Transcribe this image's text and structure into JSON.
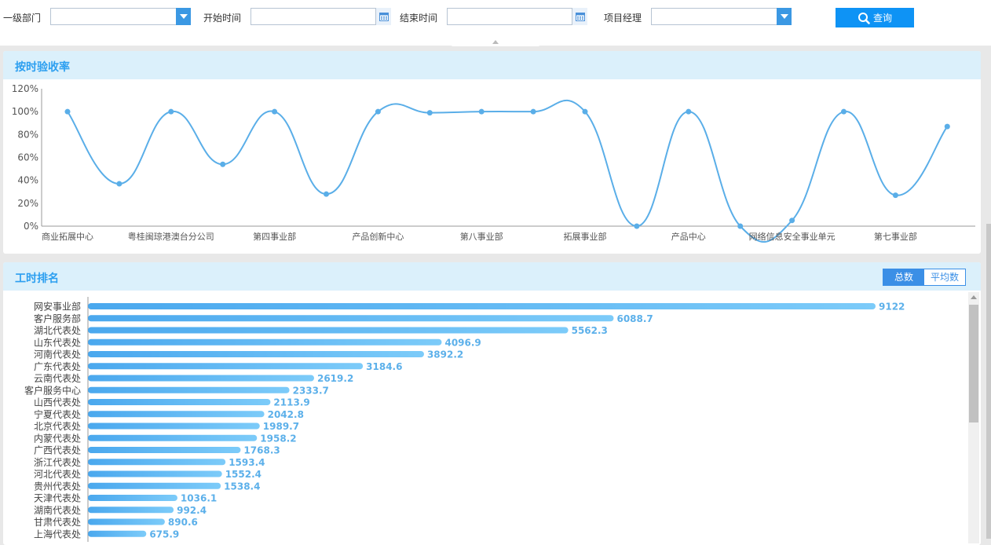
{
  "filters": {
    "dept_label": "一级部门",
    "start_label": "开始时间",
    "end_label": "结束时间",
    "manager_label": "项目经理",
    "dept_value": "",
    "start_value": "",
    "end_value": "",
    "manager_value": "",
    "query_label": "查询"
  },
  "colors": {
    "accent": "#2c9ff0",
    "line": "#5aaee8",
    "bar": "#5cb8f5",
    "button": "#0e93f5"
  },
  "icons": [
    "chevron-down-icon",
    "calendar-icon",
    "search-icon"
  ],
  "panel1": {
    "title": "按时验收率"
  },
  "panel2": {
    "title": "工时排名",
    "toggle_total": "总数",
    "toggle_avg": "平均数"
  },
  "chart_data": [
    {
      "type": "line",
      "title": "按时验收率",
      "y_ticks": [
        "0%",
        "20%",
        "40%",
        "60%",
        "80%",
        "100%",
        "120%"
      ],
      "ylim": [
        0,
        120
      ],
      "x_labels_shown": [
        "商业拓展中心",
        "粤桂闽琼港澳台分公司",
        "第四事业部",
        "产品创新中心",
        "第八事业部",
        "拓展事业部",
        "产品中心",
        "网络信息安全事业单元",
        "第七事业部"
      ],
      "values": [
        100,
        37,
        100,
        54,
        100,
        28,
        100,
        99,
        100,
        100,
        100,
        0,
        100,
        0,
        5,
        100,
        27,
        87
      ]
    },
    {
      "type": "bar",
      "orientation": "horizontal",
      "title": "工时排名",
      "categories": [
        "网安事业部",
        "客户服务部",
        "湖北代表处",
        "山东代表处",
        "河南代表处",
        "广东代表处",
        "云南代表处",
        "客户服务中心",
        "山西代表处",
        "宁夏代表处",
        "北京代表处",
        "内蒙代表处",
        "广西代表处",
        "浙江代表处",
        "河北代表处",
        "贵州代表处",
        "天津代表处",
        "湖南代表处",
        "甘肃代表处",
        "上海代表处"
      ],
      "values": [
        "9122",
        "6088.7",
        "5562.3",
        "4096.9",
        "3892.2",
        "3184.6",
        "2619.2",
        "2333.7",
        "2113.9",
        "2042.8",
        "1989.7",
        "1958.2",
        "1768.3",
        "1593.4",
        "1552.4",
        "1538.4",
        "1036.1",
        "992.4",
        "890.6",
        "675.9"
      ]
    }
  ]
}
